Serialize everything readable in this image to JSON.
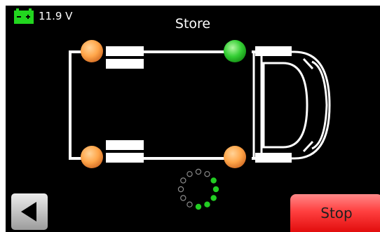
{
  "status_bar": {
    "battery_voltage": "11.9 V",
    "battery_icon": "battery-icon",
    "battery_color": "#22d61f"
  },
  "screen": {
    "title": "Store"
  },
  "vehicle": {
    "icon": "van-top-view",
    "tire_sensors": [
      {
        "position": "front-left",
        "status": "pending",
        "color": "#ffa64a"
      },
      {
        "position": "front-right",
        "status": "pending",
        "color": "#ffa64a"
      },
      {
        "position": "rear-right",
        "status": "ok",
        "color": "#2fcb2f"
      },
      {
        "position": "rear-left",
        "status": "pending",
        "color": "#ffa64a"
      }
    ]
  },
  "progress_spinner": {
    "dots_total": 12,
    "dots_active": 5,
    "active_color": "#22cc22"
  },
  "navigation": {
    "back_icon": "triangle-left-icon",
    "stop_label": "Stop",
    "stop_color": "#ff3030"
  }
}
